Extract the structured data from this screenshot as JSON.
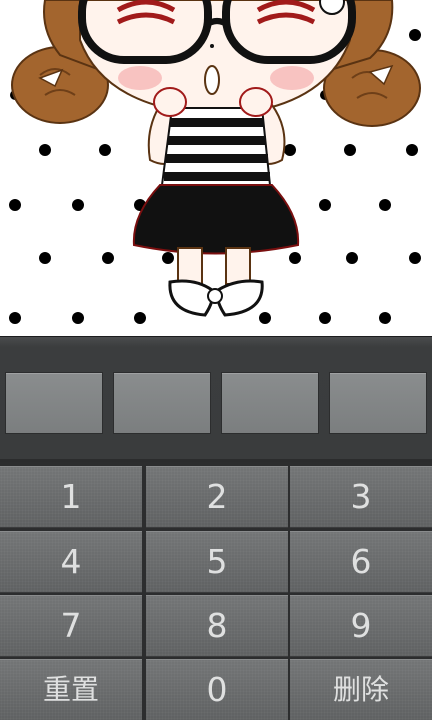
{
  "wallpaper": {
    "description_icon": "cartoon-girl-wallpaper"
  },
  "pin": {
    "slots": [
      "",
      "",
      "",
      ""
    ]
  },
  "keypad": {
    "keys": [
      {
        "label": "1"
      },
      {
        "label": "2"
      },
      {
        "label": "3"
      },
      {
        "label": "4"
      },
      {
        "label": "5"
      },
      {
        "label": "6"
      },
      {
        "label": "7"
      },
      {
        "label": "8"
      },
      {
        "label": "9"
      },
      {
        "label": "重置"
      },
      {
        "label": "0"
      },
      {
        "label": "删除"
      }
    ]
  },
  "colors": {
    "key_text": "#dfe0e0",
    "key_face": "#6a6c6d",
    "pin_box": "#828586",
    "background": "#2c2d2e"
  }
}
